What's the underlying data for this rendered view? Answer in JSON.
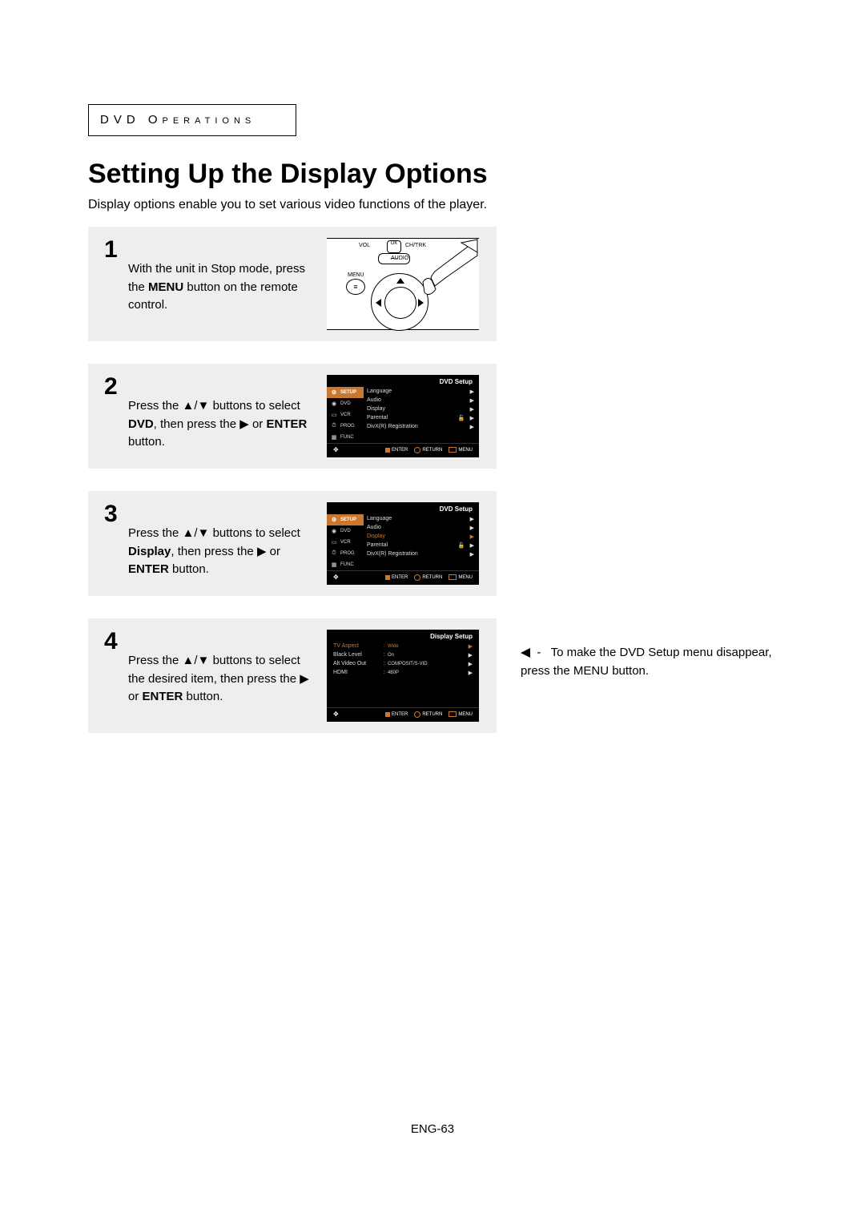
{
  "section_label": "DVD Operations",
  "title": "Setting Up the Display Options",
  "intro": "Display options enable you to set various video functions of the player.",
  "steps": {
    "s1": {
      "num": "1",
      "text_pre": "With the unit in Stop mode, press the ",
      "bold1": "MENU",
      "text_post": " button on the remote control.",
      "remote": {
        "vol": "VOL",
        "ok": "OK",
        "chtrk": "CH/TRK",
        "audio": "AUDIO",
        "menu": "MENU"
      }
    },
    "s2": {
      "num": "2",
      "text_pre": "Press the ",
      "glyph": "▲/▼",
      "text_mid": " buttons to select ",
      "bold1": "DVD",
      "text_mid2": ", then press the ",
      "play": "▶",
      "or": " or ",
      "bold2": "ENTER",
      "text_post": " button."
    },
    "s3": {
      "num": "3",
      "text_pre": "Press the ",
      "glyph": "▲/▼",
      "text_mid": " buttons to select ",
      "bold1": "Display",
      "text_mid2": ", then press the ",
      "play": "▶",
      "or": " or ",
      "bold2": "ENTER",
      "text_post": " button."
    },
    "s4": {
      "num": "4",
      "text_pre": "Press the ",
      "glyph": "▲/▼",
      "text_mid": " buttons to select the desired item, then press the ",
      "play": "▶",
      "or": " or ",
      "bold2": "ENTER",
      "text_post": " button."
    }
  },
  "osd": {
    "dvd_title": "DVD Setup",
    "display_title": "Display Setup",
    "tabs": {
      "setup": "SETUP",
      "dvd": "DVD",
      "vcr": "VCR",
      "prog": "PROG",
      "func": "FUNC"
    },
    "rows": {
      "language": "Language",
      "audio": "Audio",
      "display": "Display",
      "parental": "Parental",
      "divx": "DivX(R) Registration"
    },
    "display_rows": [
      {
        "label": "TV Aspect",
        "value": "Wide"
      },
      {
        "label": "Black Level",
        "value": "On"
      },
      {
        "label": "Alt Video Out",
        "value": "COMPOSIT/S-VID"
      },
      {
        "label": "HDMI",
        "value": "480P"
      }
    ],
    "footer": {
      "enter": "ENTER",
      "return": "RETURN",
      "menu": "MENU"
    }
  },
  "note": {
    "dash": "-",
    "text": "To make the DVD Setup menu disappear, press the MENU button."
  },
  "page_num": "ENG-63"
}
